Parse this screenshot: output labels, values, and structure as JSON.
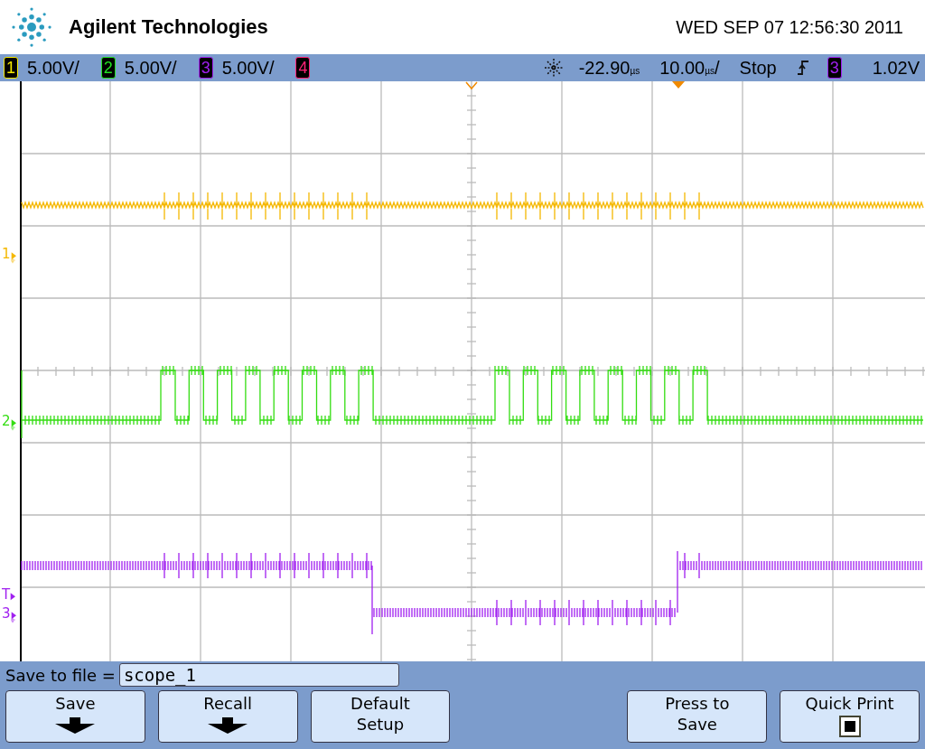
{
  "header": {
    "brand": "Agilent Technologies",
    "datetime": "WED SEP 07 12:56:30 2011"
  },
  "status_bar": {
    "channels": [
      {
        "number": "1",
        "scale": "5.00V/",
        "color": "#f5e800"
      },
      {
        "number": "2",
        "scale": "5.00V/",
        "color": "#22e022"
      },
      {
        "number": "3",
        "scale": "5.00V/",
        "color": "#a020f0"
      },
      {
        "number": "4",
        "color": "#ff2277"
      }
    ],
    "delay": {
      "value": "-22.90",
      "unit": "µs"
    },
    "timebase": {
      "value": "10.00",
      "unit": "µs",
      "suffix": "/"
    },
    "run_state": "Stop",
    "trigger": {
      "channel": {
        "number": "3",
        "color": "#a020f0"
      },
      "level": "1.02V"
    }
  },
  "markers": [
    {
      "label": "1",
      "kind": "ground",
      "color": "#f5b800"
    },
    {
      "label": "2",
      "kind": "ground",
      "color": "#33dd11"
    },
    {
      "label": "T",
      "kind": "trigger",
      "color": "#a020f0"
    },
    {
      "label": "3",
      "kind": "ground",
      "color": "#a020f0"
    }
  ],
  "softkeys": {
    "save_to_file": {
      "label": "Save to file =",
      "value": "scope_1"
    },
    "buttons": [
      {
        "kind": "arrow",
        "label": "Save"
      },
      {
        "kind": "arrow",
        "label": "Recall"
      },
      {
        "kind": "plain",
        "label": "Default Setup"
      },
      {
        "kind": "empty"
      },
      {
        "kind": "plain",
        "label": "Press to Save"
      },
      {
        "kind": "checkbox",
        "label": "Quick Print",
        "checked": true
      }
    ]
  }
}
